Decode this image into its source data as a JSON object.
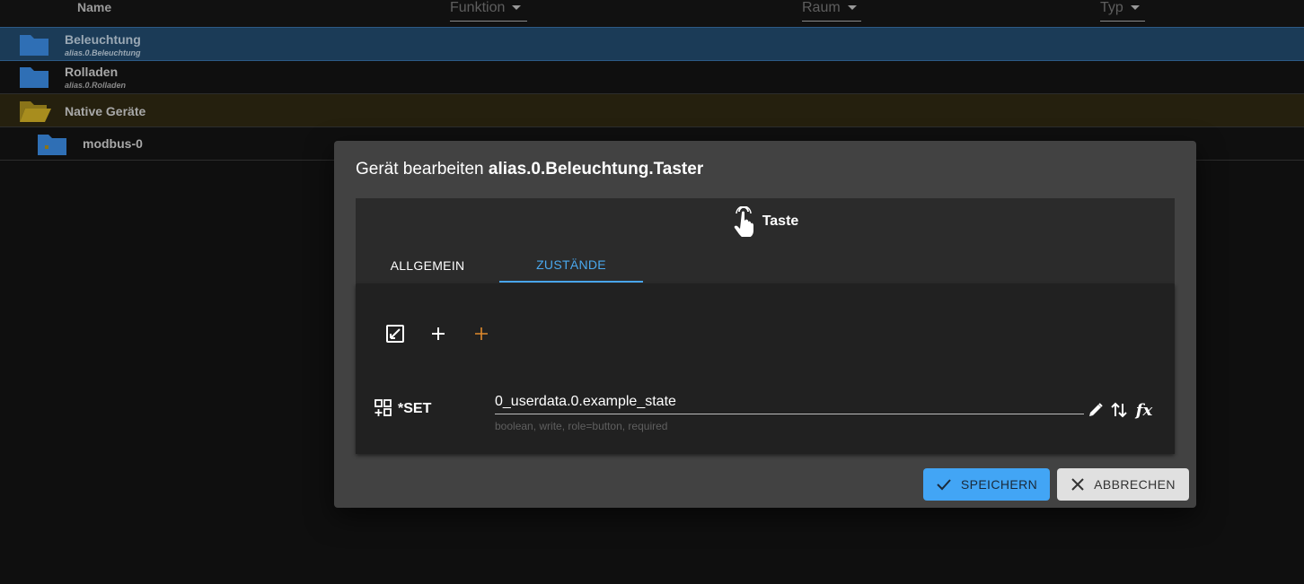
{
  "list": {
    "header": {
      "name": "Name",
      "function": "Funktion",
      "room": "Raum",
      "type": "Typ"
    },
    "rows": [
      {
        "title": "Beleuchtung",
        "subtitle": "alias.0.Beleuchtung"
      },
      {
        "title": "Rolladen",
        "subtitle": "alias.0.Rolladen"
      },
      {
        "title": "Native Geräte"
      },
      {
        "title": "modbus-0"
      }
    ]
  },
  "dialog": {
    "title_prefix": "Gerät bearbeiten",
    "title_id": "alias.0.Beleuchtung.Taster",
    "device_type": "Taste",
    "tabs": [
      {
        "label": "ALLGEMEIN"
      },
      {
        "label": "ZUSTÄNDE"
      }
    ],
    "state": {
      "name": "*SET",
      "value": "0_userdata.0.example_state",
      "help": "boolean, write, role=button, required"
    },
    "buttons": {
      "save": "SPEICHERN",
      "cancel": "ABBRECHEN"
    }
  },
  "colors": {
    "accent": "#42a5f5",
    "selected_row": "#1b3b57",
    "native_row": "#25200e",
    "add_orange": "#e08a2c"
  },
  "icons": {
    "folder": "folder-icon",
    "folder_open": "folder-open-icon",
    "touch": "touch-icon",
    "expand": "expand-icon",
    "add": "add-icon",
    "add_orange": "add-orange-icon",
    "state": "state-icon",
    "edit": "edit-icon",
    "swap": "swap-vert-icon",
    "fx": "function-icon",
    "check": "check-icon",
    "close": "close-icon"
  }
}
